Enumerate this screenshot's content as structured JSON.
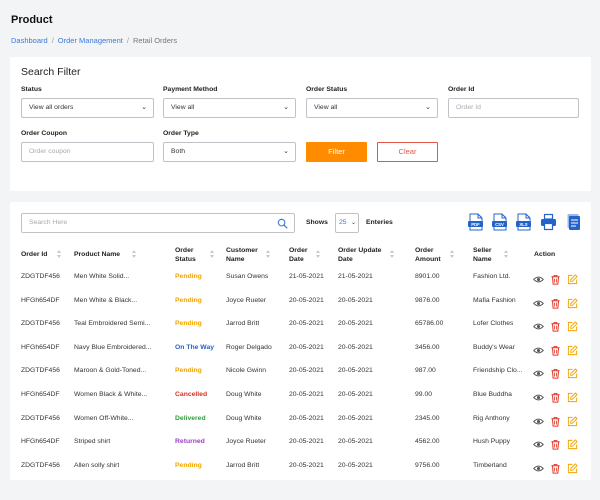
{
  "page": {
    "title": "Product"
  },
  "breadcrumb": {
    "items": [
      "Dashboard",
      "Order Management",
      "Retail Orders"
    ],
    "separator": "/"
  },
  "filter": {
    "title": "Search Filter",
    "status": {
      "label": "Status",
      "value": "View all orders"
    },
    "payment_method": {
      "label": "Payment Method",
      "value": "View all"
    },
    "order_status": {
      "label": "Order Status",
      "value": "View all"
    },
    "order_id": {
      "label": "Order Id",
      "placeholder": "Order Id"
    },
    "order_coupon": {
      "label": "Order Coupon",
      "placeholder": "Order coupon"
    },
    "order_type": {
      "label": "Order Type",
      "value": "Both"
    },
    "filter_label": "Filter",
    "clear_label": "Clear"
  },
  "table_tools": {
    "search_placeholder": "Search Here",
    "shows_label": "Shows",
    "page_size": "25",
    "entries_label": "Enteries",
    "exports": [
      "PDF",
      "CSV",
      "XLS"
    ]
  },
  "colors": {
    "accent": "#ff8c00",
    "link": "#3b7ad9",
    "danger": "#e2574c",
    "pending": "#f0a500",
    "on_the_way": "#2563c9",
    "cancelled": "#d93025",
    "delivered": "#2e9e3a",
    "returned": "#9b3fc6"
  },
  "table": {
    "columns": [
      [
        "Order Id"
      ],
      [
        "Product Name"
      ],
      [
        "Order",
        "Status"
      ],
      [
        "Customer",
        "Name"
      ],
      [
        "Order",
        "Date"
      ],
      [
        "Order Update",
        "Date"
      ],
      [
        "Order",
        "Amount"
      ],
      [
        "Seller",
        "Name"
      ],
      [
        "Action"
      ]
    ],
    "rows": [
      {
        "order_id": "ZDGTDF456",
        "product": "Men White Solid...",
        "status": "Pending",
        "status_key": "pending",
        "customer": "Susan Owens",
        "order_date": "21-05-2021",
        "update_date": "21-05-2021",
        "amount": "8901.00",
        "seller": "Fashion Ltd."
      },
      {
        "order_id": "HFGh654DF",
        "product": "Men White & Black...",
        "status": "Pending",
        "status_key": "pending",
        "customer": "Joyce Rueter",
        "order_date": "20-05-2021",
        "update_date": "20-05-2021",
        "amount": "9876.00",
        "seller": "Mafia Fashion"
      },
      {
        "order_id": "ZDGTDF456",
        "product": "Teal Embroidered Semi...",
        "status": "Pending",
        "status_key": "pending",
        "customer": "Jarrod Britt",
        "order_date": "20-05-2021",
        "update_date": "20-05-2021",
        "amount": "65786.00",
        "seller": "Lofer Clothes"
      },
      {
        "order_id": "HFGh654DF",
        "product": "Navy Blue Embroidered...",
        "status": "On The Way",
        "status_key": "ontheway",
        "customer": "Roger Delgado",
        "order_date": "20-05-2021",
        "update_date": "20-05-2021",
        "amount": "3456.00",
        "seller": "Buddy's Wear"
      },
      {
        "order_id": "ZDGTDF456",
        "product": "Maroon & Gold-Toned...",
        "status": "Pending",
        "status_key": "pending",
        "customer": "Nicole Gwinn",
        "order_date": "20-05-2021",
        "update_date": "20-05-2021",
        "amount": "987.00",
        "seller": "Friendship Clo..."
      },
      {
        "order_id": "HFGh654DF",
        "product": "Women Black & White...",
        "status": "Cancelled",
        "status_key": "cancelled",
        "customer": "Doug White",
        "order_date": "20-05-2021",
        "update_date": "20-05-2021",
        "amount": "99.00",
        "seller": "Blue Buddha"
      },
      {
        "order_id": "ZDGTDF456",
        "product": "Women Off-White...",
        "status": "Delivered",
        "status_key": "delivered",
        "customer": "Doug White",
        "order_date": "20-05-2021",
        "update_date": "20-05-2021",
        "amount": "2345.00",
        "seller": "Rig Anthony"
      },
      {
        "order_id": "HFGh654DF",
        "product": "Striped shirt",
        "status": "Returned",
        "status_key": "returned",
        "customer": "Joyce Rueter",
        "order_date": "20-05-2021",
        "update_date": "20-05-2021",
        "amount": "4562.00",
        "seller": "Hush Puppy"
      },
      {
        "order_id": "ZDGTDF456",
        "product": "Allen solly shirt",
        "status": "Pending",
        "status_key": "pending",
        "customer": "Jarrod Britt",
        "order_date": "20-05-2021",
        "update_date": "20-05-2021",
        "amount": "9756.00",
        "seller": "Timberland"
      }
    ],
    "row_actions": [
      "eye-icon",
      "trash-icon",
      "edit-icon"
    ]
  }
}
